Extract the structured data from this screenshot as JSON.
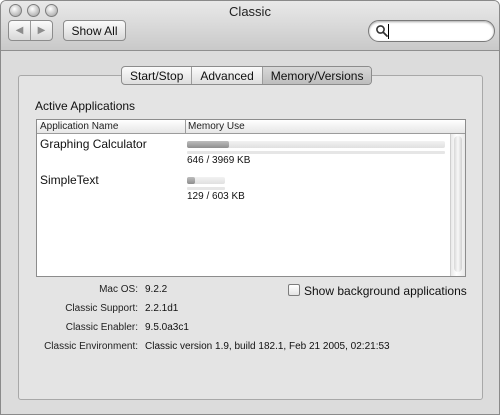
{
  "window": {
    "title": "Classic"
  },
  "toolbar": {
    "show_all_label": "Show All",
    "back_icon": "left-arrow-icon",
    "forward_icon": "right-arrow-icon",
    "search": {
      "value": "",
      "placeholder": "",
      "icon": "search-icon"
    }
  },
  "tabs": [
    {
      "label": "Start/Stop",
      "selected": false
    },
    {
      "label": "Advanced",
      "selected": false
    },
    {
      "label": "Memory/Versions",
      "selected": true
    }
  ],
  "active_apps": {
    "title": "Active Applications",
    "columns": [
      "Application Name",
      "Memory Use"
    ],
    "rows": [
      {
        "name": "Graphing Calculator",
        "memory": "646 / 3969 KB",
        "fraction": 0.163
      },
      {
        "name": "SimpleText",
        "memory": "129 / 603 KB",
        "fraction": 0.214
      }
    ]
  },
  "info": {
    "mac_os_label": "Mac OS:",
    "mac_os_value": "9.2.2",
    "classic_support_label": "Classic Support:",
    "classic_support_value": "2.2.1d1",
    "classic_enabler_label": "Classic Enabler:",
    "classic_enabler_value": "9.5.0a3c1",
    "classic_environment_label": "Classic Environment:",
    "classic_environment_value": "Classic version 1.9, build 182.1, Feb 21 2005, 02:21:53"
  },
  "show_background": {
    "label": "Show background applications",
    "checked": false
  }
}
